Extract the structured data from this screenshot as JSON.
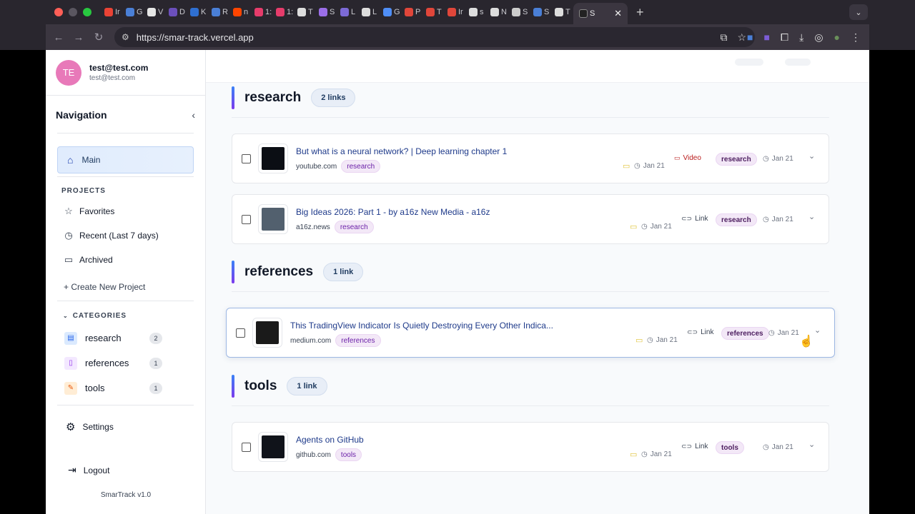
{
  "browser": {
    "url": "https://smar-track.vercel.app",
    "tabs": [
      {
        "label": "Ir",
        "color": "#ea4335"
      },
      {
        "label": "G",
        "color": "#4a7fd6"
      },
      {
        "label": "V",
        "color": "#e6e6e6"
      },
      {
        "label": "D",
        "color": "#6b4fbb"
      },
      {
        "label": "K",
        "color": "#2f6fd1"
      },
      {
        "label": "R",
        "color": "#4a7fd6"
      },
      {
        "label": "n",
        "color": "#ff4500"
      },
      {
        "label": "1:",
        "color": "#e63c6b"
      },
      {
        "label": "1:",
        "color": "#e63c6b"
      },
      {
        "label": "T",
        "color": "#dddddd"
      },
      {
        "label": "S",
        "color": "#9b6ee8"
      },
      {
        "label": "L",
        "color": "#7c6ad6"
      },
      {
        "label": "L",
        "color": "#dddddd"
      },
      {
        "label": "G",
        "color": "#4f8ef7"
      },
      {
        "label": "P",
        "color": "#e0463a"
      },
      {
        "label": "T",
        "color": "#e0463a"
      },
      {
        "label": "Ir",
        "color": "#e0463a"
      },
      {
        "label": "s",
        "color": "#dddddd"
      },
      {
        "label": "N",
        "color": "#dddddd"
      },
      {
        "label": "S",
        "color": "#cccccc"
      },
      {
        "label": "S",
        "color": "#4a7fd6"
      },
      {
        "label": "T",
        "color": "#dddddd"
      }
    ],
    "active_tab": {
      "label": "S"
    }
  },
  "user": {
    "initials": "TE",
    "name": "test@test.com",
    "email": "test@test.com"
  },
  "sidebar": {
    "nav_title": "Navigation",
    "main_label": "Main",
    "projects_heading": "PROJECTS",
    "projects": [
      {
        "label": "Favorites",
        "icon": "star-icon"
      },
      {
        "label": "Recent (Last 7 days)",
        "icon": "clock-icon"
      },
      {
        "label": "Archived",
        "icon": "archive-icon"
      }
    ],
    "create_project": "+ Create New Project",
    "categories_heading": "CATEGORIES",
    "categories": [
      {
        "label": "research",
        "count": "2",
        "icon": "book-icon",
        "bg": "#dbeafe",
        "fg": "#2563eb"
      },
      {
        "label": "references",
        "count": "1",
        "icon": "bookmark-icon",
        "bg": "#f3e8ff",
        "fg": "#9333ea"
      },
      {
        "label": "tools",
        "count": "1",
        "icon": "wrench-icon",
        "bg": "#ffedd5",
        "fg": "#ea580c"
      }
    ],
    "settings": "Settings",
    "logout": "Logout",
    "version": "SmarTrack v1.0"
  },
  "sections": [
    {
      "name": "research",
      "pill": "2 links",
      "links": [
        {
          "title": "But what is a neural network? | Deep learning chapter 1",
          "domain": "youtube.com",
          "tag": "research",
          "date1": "Jan 21",
          "kind": "Video",
          "category": "research",
          "date2": "Jan 21"
        },
        {
          "title": "Big Ideas 2026: Part 1 - by a16z New Media - a16z",
          "domain": "a16z.news",
          "tag": "research",
          "date1": "Jan 21",
          "kind": "Link",
          "category": "research",
          "date2": "Jan 21"
        }
      ]
    },
    {
      "name": "references",
      "pill": "1 link",
      "links": [
        {
          "title": "This TradingView Indicator Is Quietly Destroying Every Other Indica...",
          "domain": "medium.com",
          "tag": "references",
          "date1": "Jan 21",
          "kind": "Link",
          "category": "references",
          "date2": "Jan 21"
        }
      ]
    },
    {
      "name": "tools",
      "pill": "1 link",
      "links": [
        {
          "title": "Agents on GitHub",
          "domain": "github.com",
          "tag": "tools",
          "date1": "Jan 21",
          "kind": "Link",
          "category": "tools",
          "date2": "Jan 21"
        }
      ]
    }
  ]
}
